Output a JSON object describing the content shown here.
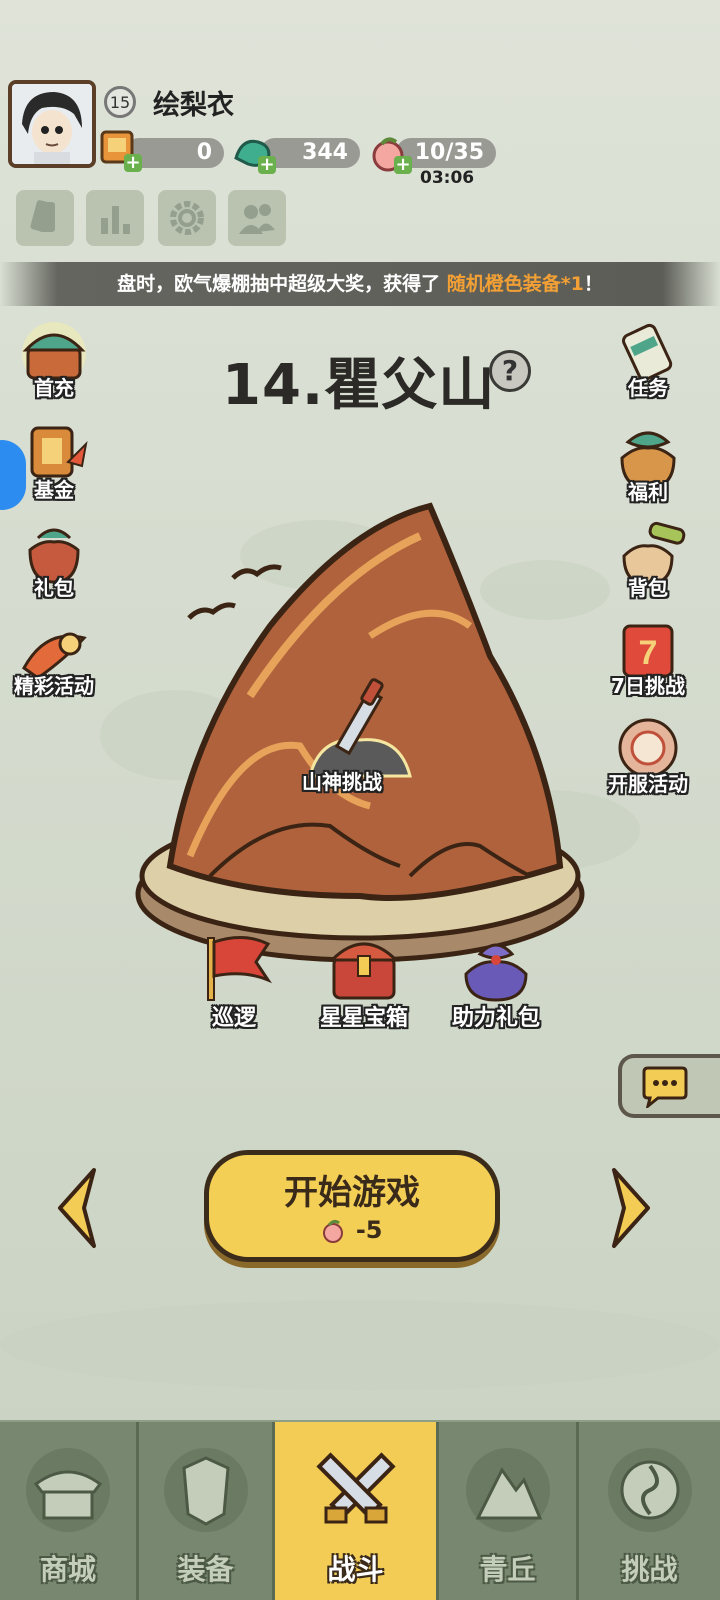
{
  "player": {
    "level": "15",
    "name": "绘梨衣"
  },
  "resources": [
    {
      "icon": "coupon-icon",
      "value": "0"
    },
    {
      "icon": "jade-dragon-icon",
      "value": "344"
    },
    {
      "icon": "peach-stamina-icon",
      "value": "10/35"
    }
  ],
  "stamina_timer": "03:06",
  "toolbar_icons": [
    "card-icon",
    "ranking-icon",
    "settings-gear-icon",
    "friends-icon"
  ],
  "marquee": {
    "prefix": "盘时，欧气爆棚抽中超级大奖，获得了 ",
    "highlight": "随机橙色装备*1",
    "suffix": "！"
  },
  "stage": {
    "title": "14.瞿父山",
    "boss_label": "山神挑战"
  },
  "left_menu": [
    {
      "label": "首充",
      "icon": "first-recharge-chest-icon"
    },
    {
      "label": "基金",
      "icon": "fund-icon"
    },
    {
      "label": "礼包",
      "icon": "gift-bag-icon"
    },
    {
      "label": "精彩活动",
      "icon": "events-icon"
    }
  ],
  "right_menu": [
    {
      "label": "任务",
      "icon": "task-scroll-icon"
    },
    {
      "label": "福利",
      "icon": "welfare-bag-icon"
    },
    {
      "label": "背包",
      "icon": "backpack-icon"
    },
    {
      "label": "7日挑战",
      "icon": "seven-day-challenge-icon"
    },
    {
      "label": "开服活动",
      "icon": "server-event-icon"
    }
  ],
  "stage_actions": [
    {
      "label": "巡逻",
      "icon": "patrol-flag-icon"
    },
    {
      "label": "星星宝箱",
      "icon": "star-chest-icon"
    },
    {
      "label": "助力礼包",
      "icon": "support-gift-icon"
    }
  ],
  "start_button": {
    "label": "开始游戏",
    "cost": "-5"
  },
  "bottom_nav": [
    {
      "label": "商城",
      "active": false
    },
    {
      "label": "装备",
      "active": false
    },
    {
      "label": "战斗",
      "active": true
    },
    {
      "label": "青丘",
      "active": false
    },
    {
      "label": "挑战",
      "active": false
    }
  ],
  "colors": {
    "accent_yellow": "#f2cc55",
    "highlight_orange": "#f2a035",
    "mountain": "#b0623d"
  }
}
